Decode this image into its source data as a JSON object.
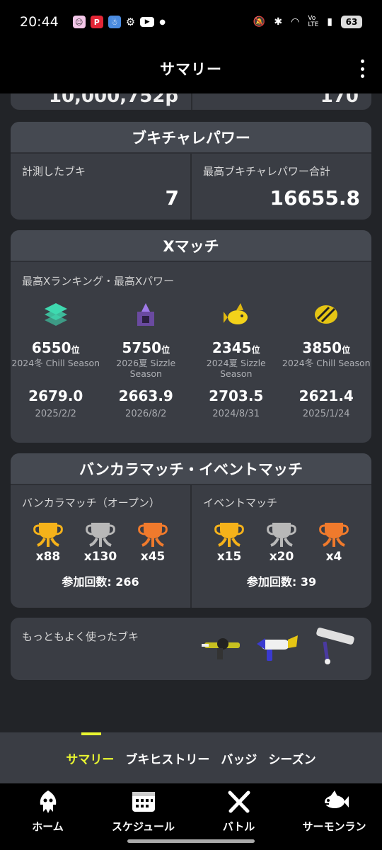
{
  "status_bar": {
    "time": "20:44",
    "battery": "63"
  },
  "app_bar": {
    "title": "サマリー"
  },
  "partial_card": {
    "left_value": "10,000,752p",
    "right_value": "170"
  },
  "buki_power": {
    "title": "ブキチャレパワー",
    "measured_label": "計測したブキ",
    "measured_value": "7",
    "best_label": "最高ブキチャレパワー合計",
    "best_value": "16655.8"
  },
  "x_match": {
    "title": "Xマッチ",
    "subtitle": "最高Xランキング・最高Xパワー",
    "rank_suffix": "位",
    "entries": [
      {
        "rank": "6550",
        "season": "2024冬 Chill Season",
        "power": "2679.0",
        "date": "2025/2/2",
        "icon": "layered-tower-icon",
        "color": "#3fd9b0"
      },
      {
        "rank": "5750",
        "season": "2026夏 Sizzle Season",
        "power": "2663.9",
        "date": "2026/8/2",
        "icon": "purple-tower-icon",
        "color": "#8a5ad6"
      },
      {
        "rank": "2345",
        "season": "2024夏 Sizzle Season",
        "power": "2703.5",
        "date": "2024/8/31",
        "icon": "golden-fish-icon",
        "color": "#f3d21a"
      },
      {
        "rank": "3850",
        "season": "2024冬 Chill Season",
        "power": "2621.4",
        "date": "2025/1/24",
        "icon": "striped-clam-icon",
        "color": "#e5c514"
      }
    ]
  },
  "bankara": {
    "title": "バンカラマッチ・イベントマッチ",
    "open_label": "バンカラマッチ（オープン）",
    "open_trophies": [
      {
        "count": "x88",
        "color": "#f5b21a",
        "icon": "gold-trophy-icon"
      },
      {
        "count": "x130",
        "color": "#b8b8b8",
        "icon": "silver-trophy-icon"
      },
      {
        "count": "x45",
        "color": "#f07a2c",
        "icon": "bronze-trophy-icon"
      }
    ],
    "open_total": "参加回数: 266",
    "event_label": "イベントマッチ",
    "event_trophies": [
      {
        "count": "x15",
        "color": "#f5b21a",
        "icon": "gold-trophy-icon"
      },
      {
        "count": "x20",
        "color": "#b8b8b8",
        "icon": "silver-trophy-icon"
      },
      {
        "count": "x4",
        "color": "#f07a2c",
        "icon": "bronze-trophy-icon"
      }
    ],
    "event_total": "参加回数: 39"
  },
  "weapons": {
    "label": "もっともよく使ったブキ"
  },
  "tabs": [
    {
      "label": "サマリー",
      "active": true
    },
    {
      "label": "ブキヒストリー",
      "active": false
    },
    {
      "label": "バッジ",
      "active": false
    },
    {
      "label": "シーズン",
      "active": false
    }
  ],
  "bottom_nav": [
    {
      "label": "ホーム",
      "icon": "squid-icon"
    },
    {
      "label": "スケジュール",
      "icon": "calendar-icon"
    },
    {
      "label": "バトル",
      "icon": "crossed-weapons-icon"
    },
    {
      "label": "サーモンラン",
      "icon": "salmon-icon"
    }
  ],
  "colors": {
    "accent": "#e8f531",
    "card": "#3a3d44",
    "background": "#222428"
  }
}
